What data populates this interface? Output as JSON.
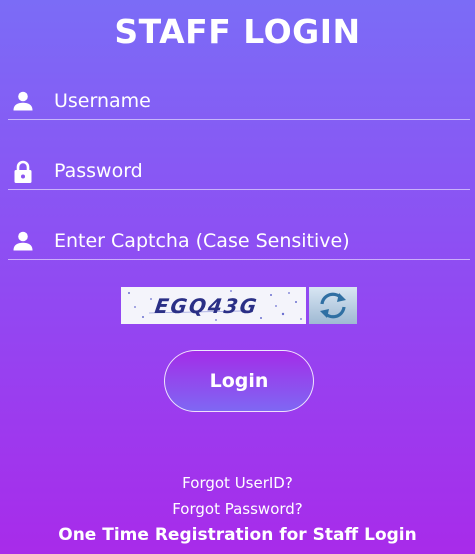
{
  "header": {
    "title": "STAFF LOGIN"
  },
  "form": {
    "username": {
      "placeholder": "Username",
      "value": "",
      "icon": "user-icon"
    },
    "password": {
      "placeholder": "Password",
      "value": "",
      "icon": "lock-icon"
    },
    "captcha_input": {
      "placeholder": "Enter Captcha (Case Sensitive)",
      "value": "",
      "icon": "user-icon"
    },
    "captcha_image_text": "EGQ43G",
    "refresh_icon": "refresh-icon",
    "login_label": "Login"
  },
  "links": {
    "forgot_userid": "Forgot UserID?",
    "forgot_password": "Forgot Password?",
    "registration": "One Time Registration for Staff Login"
  },
  "colors": {
    "gradient_top": "#7b6cf6",
    "gradient_bottom": "#a82bea",
    "text": "#ffffff"
  }
}
